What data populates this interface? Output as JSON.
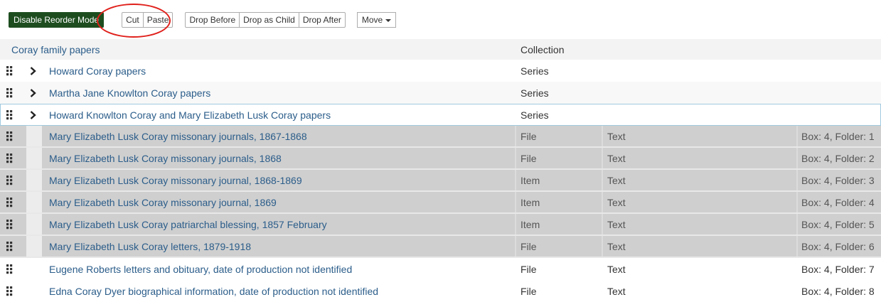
{
  "toolbar": {
    "reorder_button": "Disable Reorder Mode",
    "cut": "Cut",
    "paste": "Paste",
    "drop_before": "Drop Before",
    "drop_as_child": "Drop as Child",
    "drop_after": "Drop After",
    "move": "Move"
  },
  "root": {
    "title": "Coray family papers",
    "level": "Collection"
  },
  "rows": [
    {
      "title": "Howard Coray papers",
      "level": "Series"
    },
    {
      "title": "Martha Jane Knowlton Coray papers",
      "level": "Series"
    },
    {
      "title": "Howard Knowlton Coray and Mary Elizabeth Lusk Coray papers",
      "level": "Series"
    },
    {
      "title": "Mary Elizabeth Lusk Coray missonary journals, 1867-1868",
      "level": "File",
      "type": "Text",
      "container": "Box: 4, Folder: 1"
    },
    {
      "title": "Mary Elizabeth Lusk Coray missonary journals, 1868",
      "level": "File",
      "type": "Text",
      "container": "Box: 4, Folder: 2"
    },
    {
      "title": "Mary Elizabeth Lusk Coray missonary journal, 1868-1869",
      "level": "Item",
      "type": "Text",
      "container": "Box: 4, Folder: 3"
    },
    {
      "title": "Mary Elizabeth Lusk Coray missonary journal, 1869",
      "level": "Item",
      "type": "Text",
      "container": "Box: 4, Folder: 4"
    },
    {
      "title": "Mary Elizabeth Lusk Coray patriarchal blessing, 1857 February",
      "level": "Item",
      "type": "Text",
      "container": "Box: 4, Folder: 5"
    },
    {
      "title": "Mary Elizabeth Lusk Coray letters, 1879-1918",
      "level": "File",
      "type": "Text",
      "container": "Box: 4, Folder: 6"
    },
    {
      "title": "Eugene Roberts letters and obituary, date of production not identified",
      "level": "File",
      "type": "Text",
      "container": "Box: 4, Folder: 7"
    },
    {
      "title": "Edna Coray Dyer biographical information, date of production not identified",
      "level": "File",
      "type": "Text",
      "container": "Box: 4, Folder: 8"
    }
  ],
  "colors": {
    "primary_button": "#1d4d1f",
    "link": "#2b5d8a",
    "selected_row": "#cfcfcf",
    "annotation_circle": "#e0201b"
  }
}
